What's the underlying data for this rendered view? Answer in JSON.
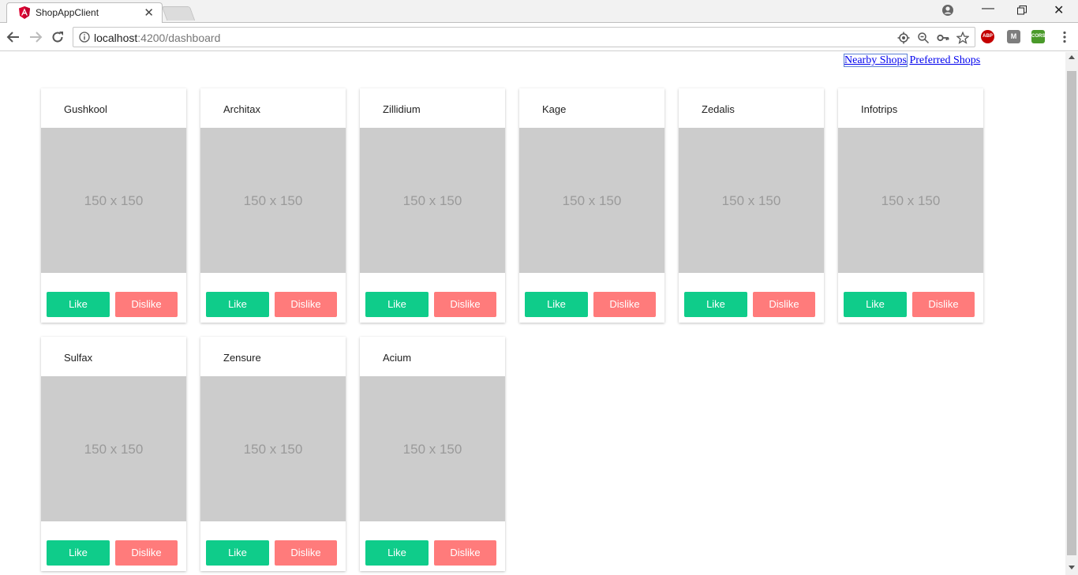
{
  "browser": {
    "tab_title": "ShopAppClient",
    "url_host": "localhost",
    "url_path": ":4200/dashboard",
    "extensions": [
      "ABP",
      "M",
      "CORS"
    ]
  },
  "nav": {
    "nearby": "Nearby Shops",
    "preferred": "Preferred Shops"
  },
  "shops": [
    {
      "name": "Gushkool",
      "placeholder": "150 x 150",
      "like": "Like",
      "dislike": "Dislike"
    },
    {
      "name": "Architax",
      "placeholder": "150 x 150",
      "like": "Like",
      "dislike": "Dislike"
    },
    {
      "name": "Zillidium",
      "placeholder": "150 x 150",
      "like": "Like",
      "dislike": "Dislike"
    },
    {
      "name": "Kage",
      "placeholder": "150 x 150",
      "like": "Like",
      "dislike": "Dislike"
    },
    {
      "name": "Zedalis",
      "placeholder": "150 x 150",
      "like": "Like",
      "dislike": "Dislike"
    },
    {
      "name": "Infotrips",
      "placeholder": "150 x 150",
      "like": "Like",
      "dislike": "Dislike"
    },
    {
      "name": "Sulfax",
      "placeholder": "150 x 150",
      "like": "Like",
      "dislike": "Dislike"
    },
    {
      "name": "Zensure",
      "placeholder": "150 x 150",
      "like": "Like",
      "dislike": "Dislike"
    },
    {
      "name": "Acium",
      "placeholder": "150 x 150",
      "like": "Like",
      "dislike": "Dislike"
    }
  ],
  "colors": {
    "like": "#0fcc8a",
    "dislike": "#ff7b7b",
    "placeholder_bg": "#cccccc",
    "link": "#0000ee"
  }
}
